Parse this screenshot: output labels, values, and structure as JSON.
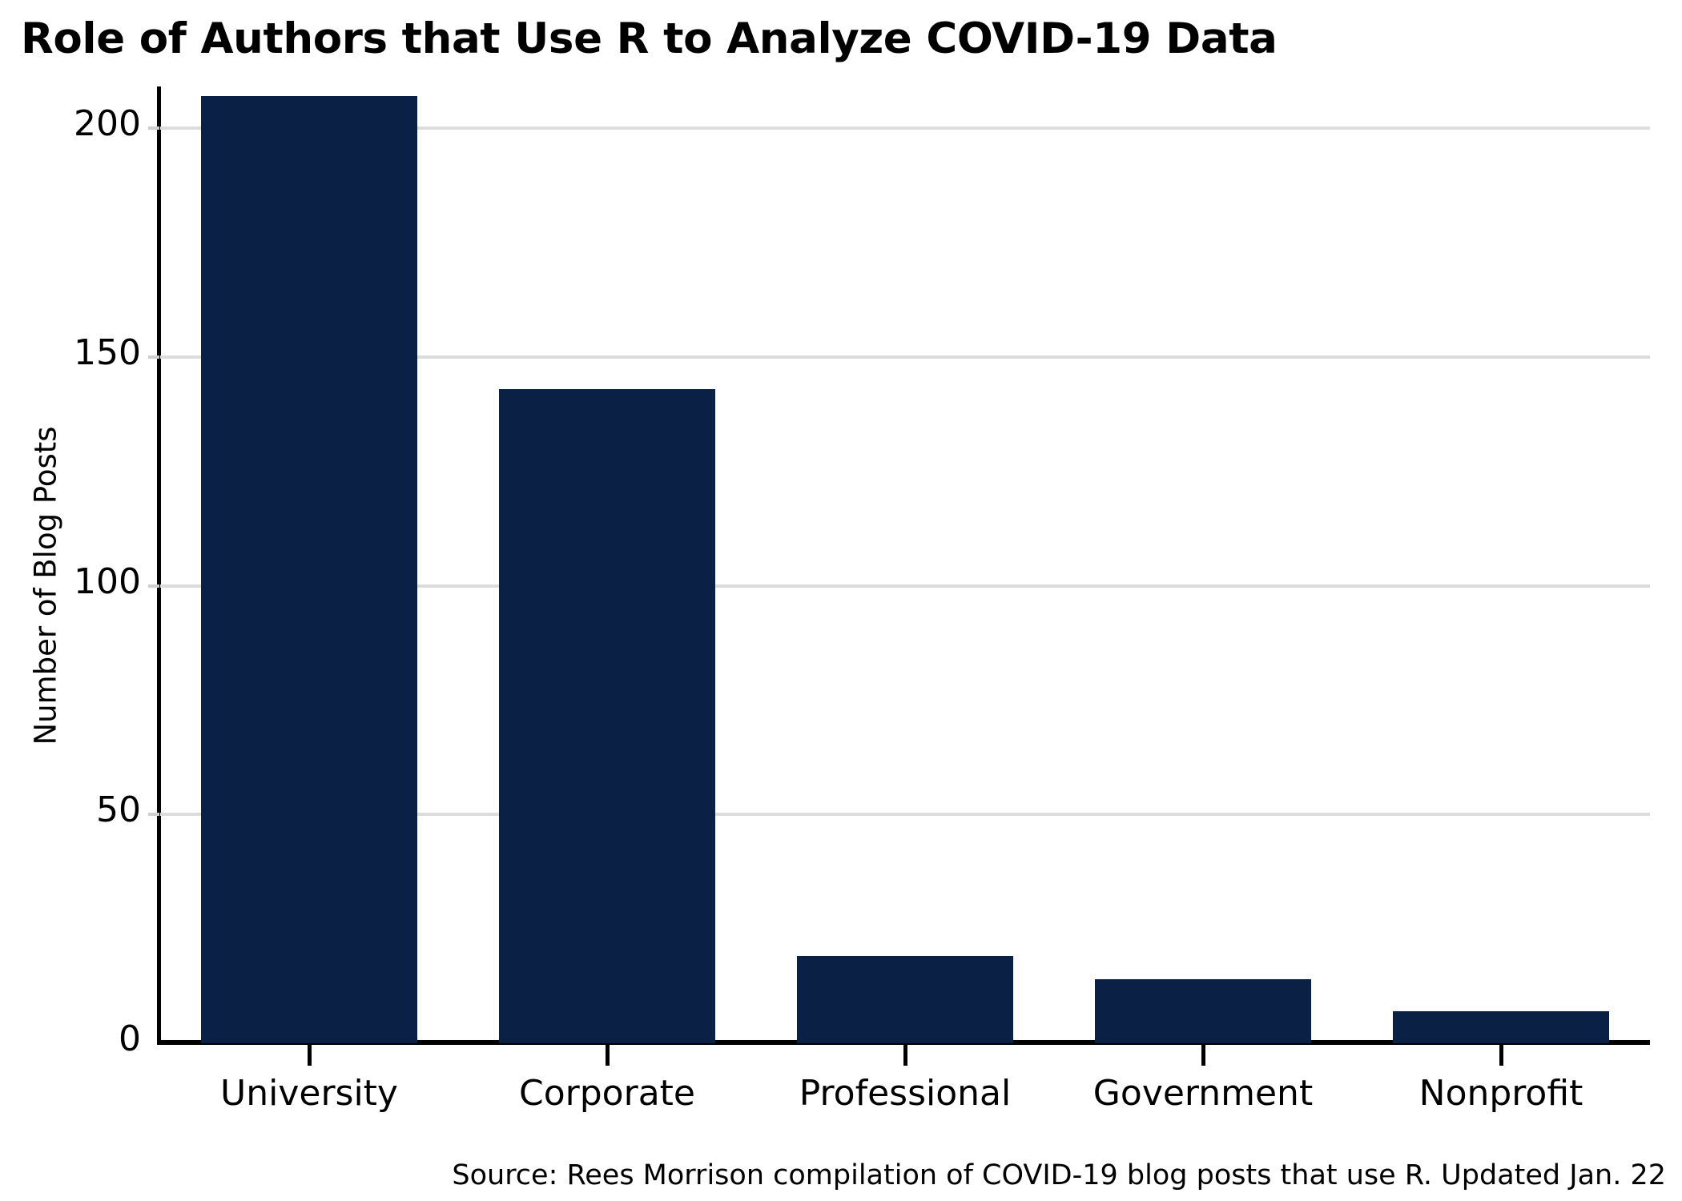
{
  "chart_data": {
    "type": "bar",
    "title": "Role of Authors that Use R to Analyze COVID-19 Data",
    "xlabel": "",
    "ylabel": "Number of Blog Posts",
    "categories": [
      "University",
      "Corporate",
      "Professional",
      "Government",
      "Nonprofit"
    ],
    "values": [
      207,
      143,
      19,
      14,
      7
    ],
    "ylim": [
      0,
      207
    ],
    "yticks": [
      0,
      50,
      100,
      150,
      200
    ],
    "ytick_labels": [
      "0",
      "50",
      "100",
      "150",
      "200"
    ],
    "grid": "horizontal",
    "legend": "none",
    "bar_color": "#0a2044",
    "gridline_color": "#dcdcdc",
    "axis_color": "#000000",
    "background": "#ffffff",
    "source": "Source: Rees Morrison compilation of COVID-19 blog posts that use R. Updated Jan. 22"
  }
}
